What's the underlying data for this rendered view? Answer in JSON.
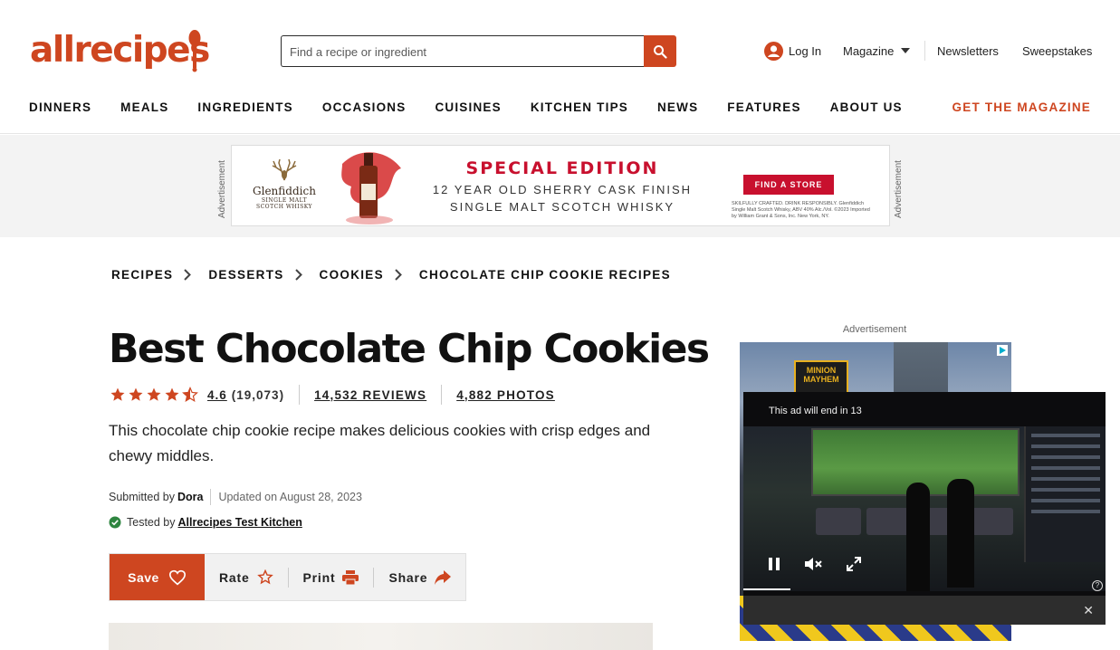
{
  "brand": {
    "logo_text": "allrecipes",
    "accent": "#ce4620"
  },
  "search": {
    "placeholder": "Find a recipe or ingredient"
  },
  "utility": {
    "login": "Log In",
    "magazine": "Magazine",
    "newsletters": "Newsletters",
    "sweepstakes": "Sweepstakes"
  },
  "nav": {
    "items": [
      "DINNERS",
      "MEALS",
      "INGREDIENTS",
      "OCCASIONS",
      "CUISINES",
      "KITCHEN TIPS",
      "NEWS",
      "FEATURES",
      "ABOUT US"
    ],
    "cta": "GET THE MAGAZINE"
  },
  "top_ad": {
    "label": "Advertisement",
    "brand": "Glenfiddich",
    "brand_sub": "SINGLE MALT SCOTCH WHISKY",
    "headline": "SPECIAL EDITION",
    "line1": "12 YEAR OLD SHERRY CASK FINISH",
    "line2": "SINGLE MALT SCOTCH WHISKY",
    "cta": "FIND A STORE",
    "fine_print": "SKILFULLY CRAFTED. DRINK RESPONSIBLY. Glenfiddich Single Malt Scotch Whisky, ABV 40% Alc./Vol. ©2023 Imported by William Grant & Sons, Inc. New York, NY."
  },
  "breadcrumb": [
    "RECIPES",
    "DESSERTS",
    "COOKIES",
    "CHOCOLATE CHIP COOKIE RECIPES"
  ],
  "recipe": {
    "title": "Best Chocolate Chip Cookies",
    "rating": "4.6",
    "rating_fraction": 0.92,
    "rating_count": "(19,073)",
    "reviews": "14,532 REVIEWS",
    "photos": "4,882 PHOTOS",
    "description": "This chocolate chip cookie recipe makes delicious cookies with crisp edges and chewy middles.",
    "submitted_label": "Submitted by",
    "author": "Dora",
    "updated": "Updated on August 28, 2023",
    "tested_label": "Tested by",
    "tested_by": "Allrecipes Test Kitchen"
  },
  "actions": {
    "save": "Save",
    "rate": "Rate",
    "print": "Print",
    "share": "Share"
  },
  "side_ad": {
    "label": "Advertisement",
    "sign_text": "MINION MAYHEM",
    "video_message": "This ad will end in 13",
    "close": "✕",
    "help": "?"
  }
}
